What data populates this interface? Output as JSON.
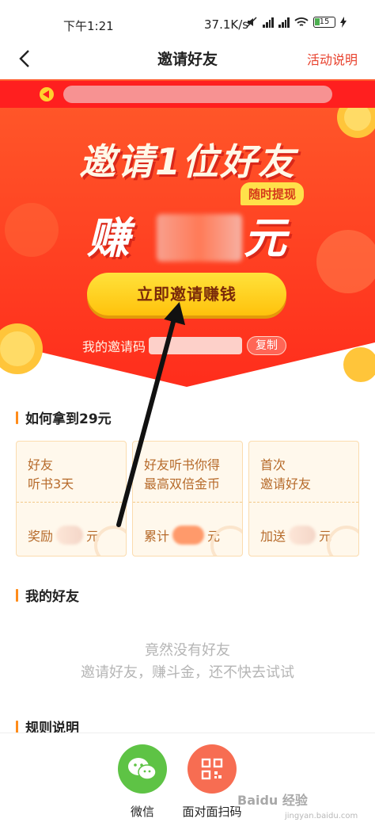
{
  "status_bar": {
    "time": "下午1:21",
    "network_speed": "37.1K/s",
    "battery": "15"
  },
  "nav": {
    "title": "邀请好友",
    "rules_link": "活动说明"
  },
  "banner": {
    "headline": "邀请1位好友",
    "badge": "随时提现",
    "earn_prefix": "赚",
    "earn_suffix": "元",
    "invite_button": "立即邀请赚钱",
    "code_label": "我的邀请码",
    "copy_button": "复制"
  },
  "how_to_earn": {
    "title": "如何拿到29元",
    "cards": [
      {
        "line1": "好友",
        "line2": "听书3天",
        "reward_prefix": "奖励",
        "reward_suffix": "元"
      },
      {
        "line1": "好友听书你得",
        "line2": "最高双倍金币",
        "reward_prefix": "累计",
        "reward_suffix": "元"
      },
      {
        "line1": "首次",
        "line2": "邀请好友",
        "reward_prefix": "加送",
        "reward_suffix": "元"
      }
    ]
  },
  "my_friends": {
    "title": "我的好友",
    "empty_line1": "竟然没有好友",
    "empty_line2": "邀请好友，赚斗金，还不快去试试"
  },
  "rules": {
    "title": "规则说明"
  },
  "share": {
    "wechat_label": "微信",
    "qr_label": "面对面扫码"
  },
  "watermark": {
    "text": "Baidu 经验",
    "sub": "jingyan.baidu.com"
  },
  "colors": {
    "accent_red": "#ff3b1f",
    "button_yellow": "#ffd21f",
    "link_red": "#e8422e",
    "wechat_green": "#5ec345",
    "qr_orange": "#f76d52"
  }
}
